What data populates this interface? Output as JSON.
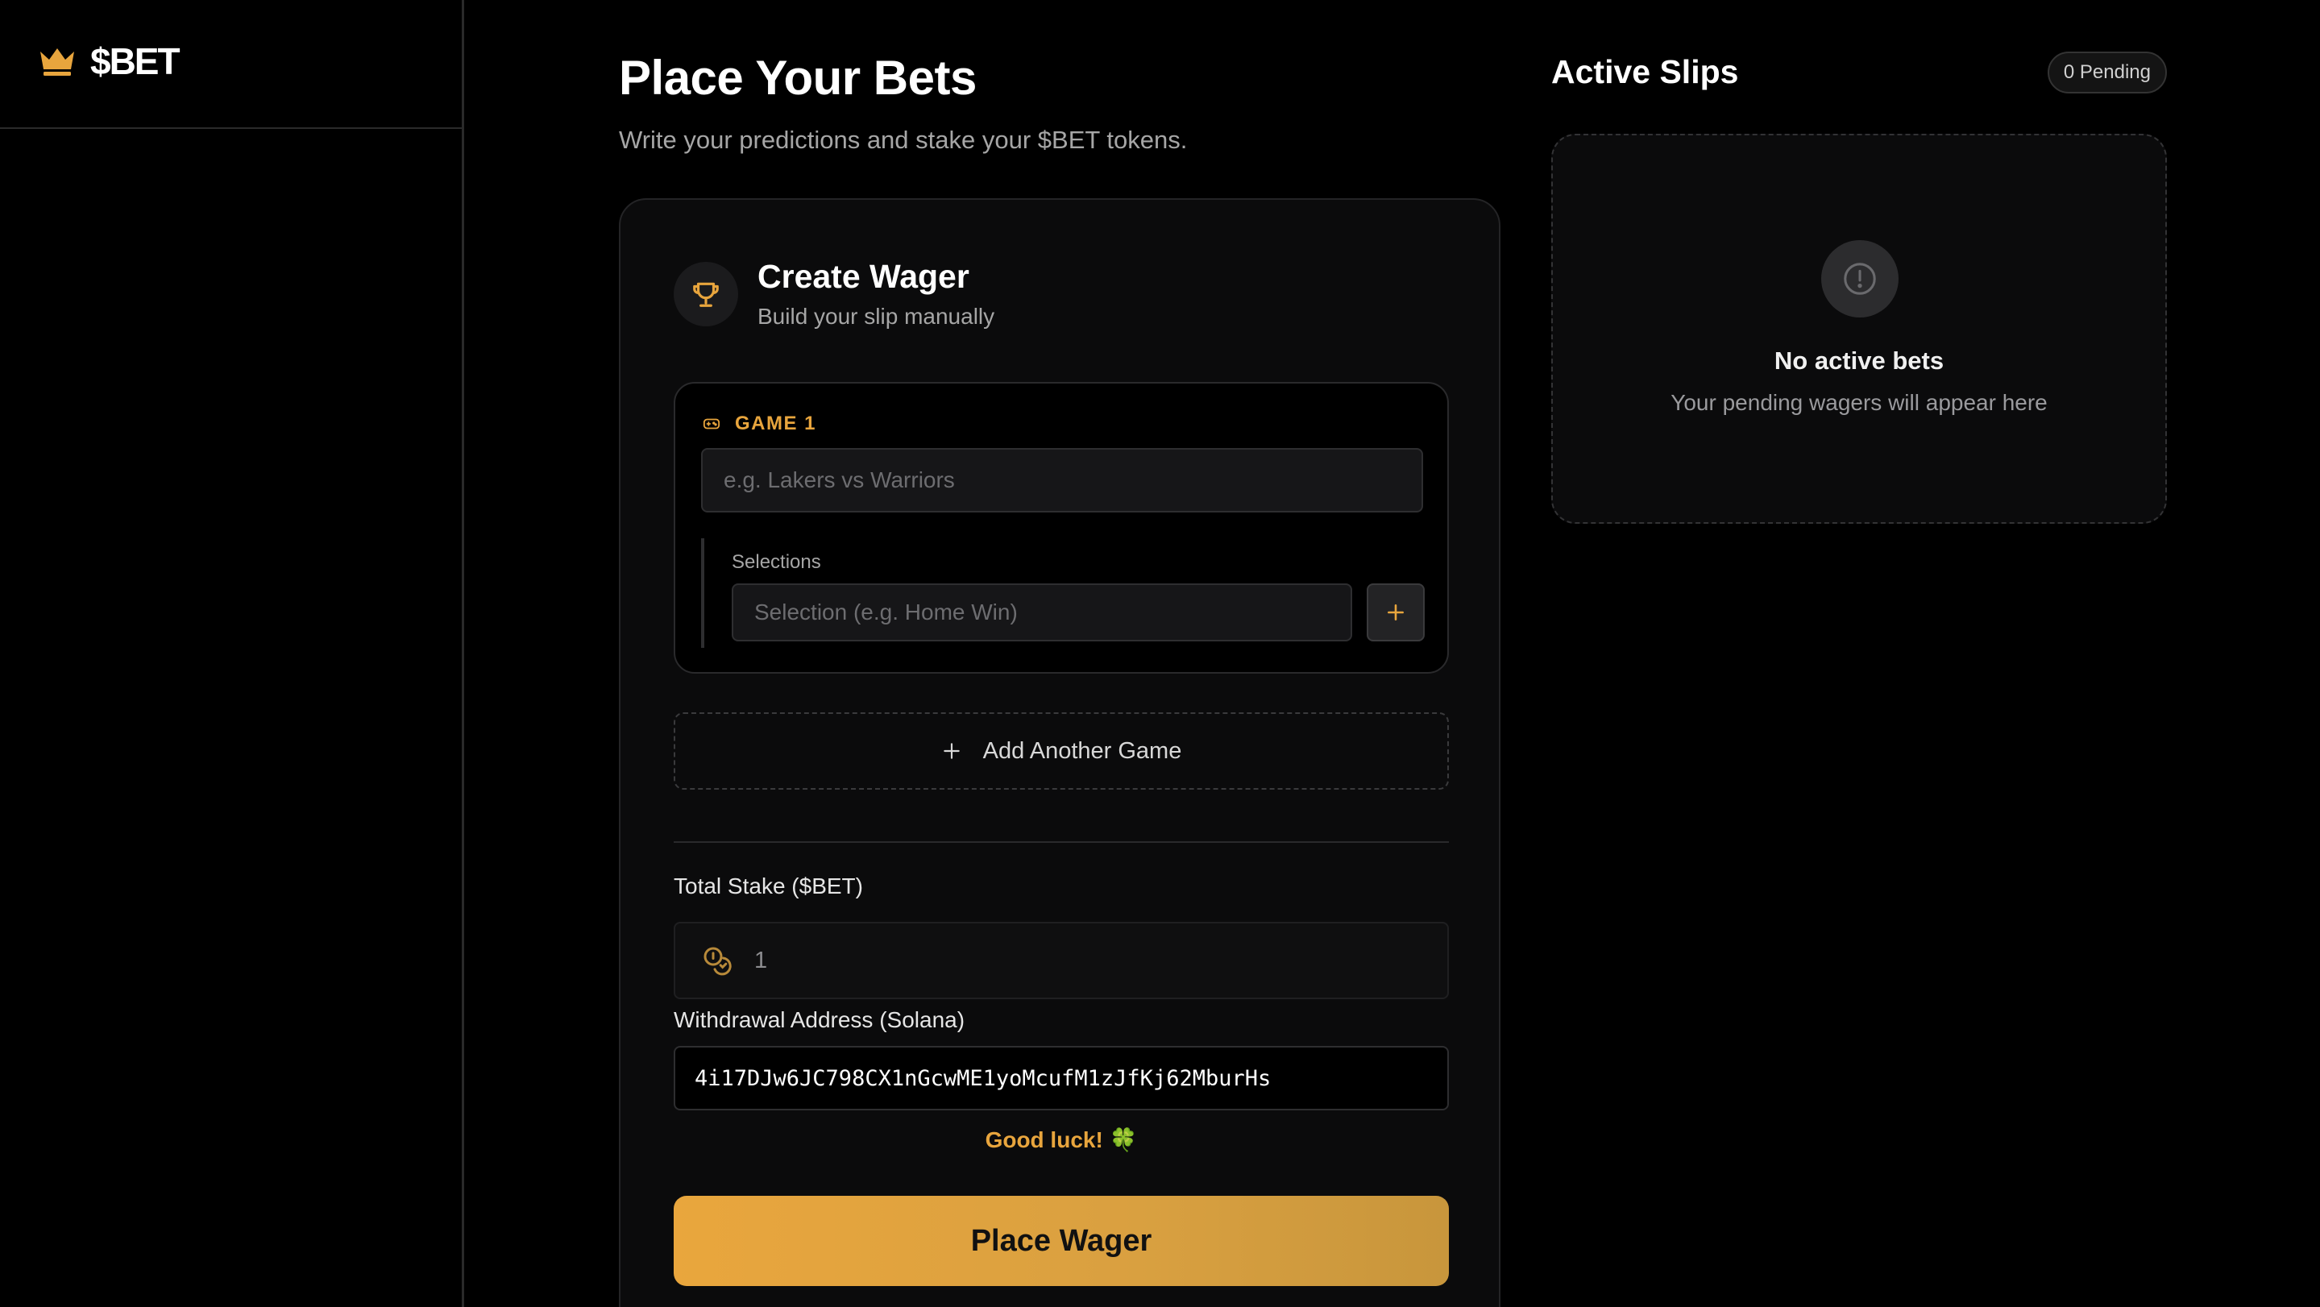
{
  "brand": {
    "name": "$BET",
    "accent": "#e8a53d"
  },
  "page": {
    "title": "Place Your Bets",
    "subtitle": "Write your predictions and stake your $BET tokens."
  },
  "wager_card": {
    "title": "Create Wager",
    "subtitle": "Build your slip manually",
    "game": {
      "label": "GAME 1",
      "input_placeholder": "e.g. Lakers vs Warriors",
      "input_value": "",
      "selections_label": "Selections",
      "selection_placeholder": "Selection (e.g. Home Win)"
    },
    "add_game_label": "Add Another Game",
    "stake": {
      "label": "Total Stake ($BET)",
      "value": "1"
    },
    "withdrawal": {
      "label": "Withdrawal Address (Solana)",
      "value": "4i17DJw6JC798CX1nGcwME1yoMcufM1zJfKj62MburHs"
    },
    "good_luck": "Good luck! 🍀",
    "submit_label": "Place Wager"
  },
  "slips": {
    "title": "Active Slips",
    "pending_badge": "0 Pending",
    "empty_title": "No active bets",
    "empty_subtitle": "Your pending wagers will appear here"
  },
  "icons": {
    "logo": "crown-icon",
    "card": "trophy-icon",
    "game": "gamepad-icon",
    "add_selection": "plus-icon",
    "add_game": "plus-icon",
    "stake": "coins-icon",
    "empty": "alert-circle-icon"
  }
}
